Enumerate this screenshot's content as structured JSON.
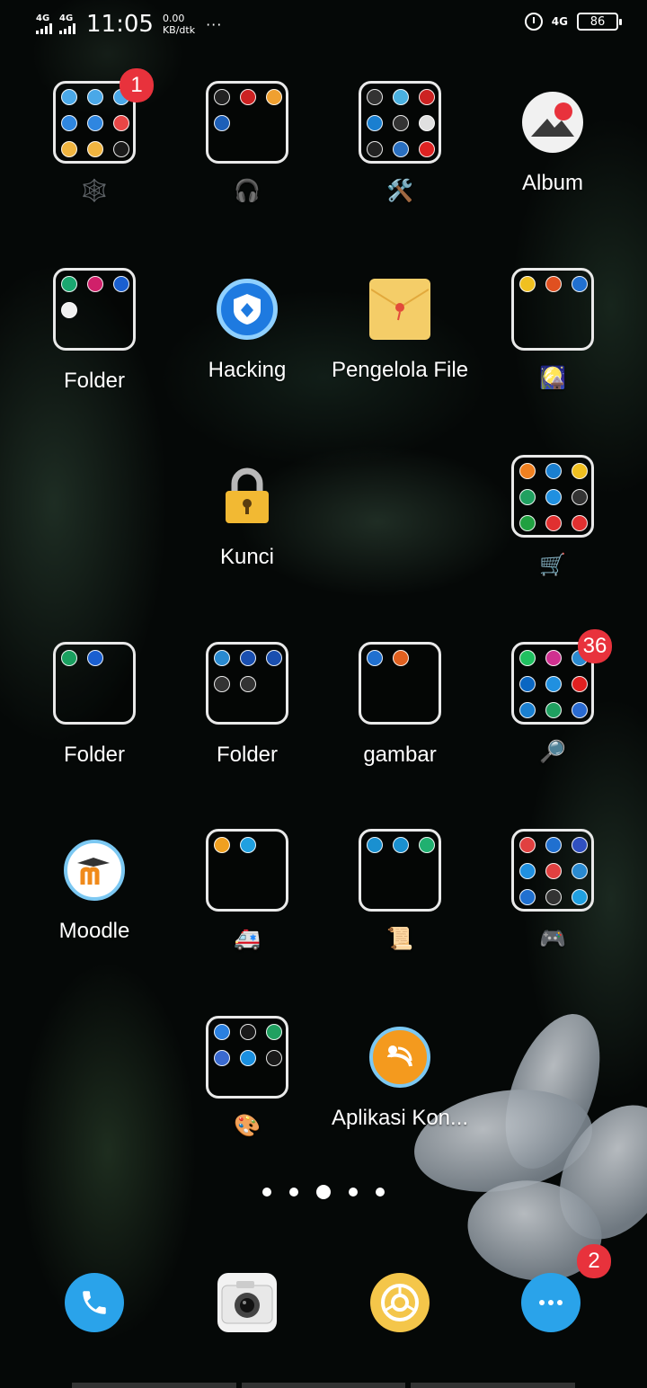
{
  "status_bar": {
    "sim1": "4G",
    "sim2": "4G",
    "time": "11:05",
    "speed_value": "0.00",
    "speed_unit": "KB/dtk",
    "more": "···",
    "net": "4G",
    "battery": "86"
  },
  "rows": [
    [
      {
        "type": "folder",
        "label": "🕸️",
        "badge": "1",
        "icon": "folder-web",
        "minis": [
          "#4aa8e8",
          "#4aa8e8",
          "#4aa8e8",
          "#2f86e0",
          "#2f86e0",
          "#e84646",
          "#f0b440",
          "#f0b440",
          "#1a1a1a"
        ]
      },
      {
        "type": "folder",
        "label": "🎧",
        "icon": "folder-music",
        "minis": [
          "#222",
          "#c22",
          "#f0a030",
          "#1d5fb8"
        ]
      },
      {
        "type": "folder",
        "label": "🛠️",
        "icon": "folder-tools",
        "minis": [
          "#333",
          "#4ab0e0",
          "#c22",
          "#1a7fd0",
          "#333",
          "#e0e0e0",
          "#222",
          "#2a6fc0",
          "#d22"
        ]
      },
      {
        "type": "app",
        "label": "Album",
        "icon": "album-icon"
      }
    ],
    [
      {
        "type": "folder",
        "label": "Folder",
        "icon": "folder-generic",
        "minis": [
          "#1aa870",
          "#d0206a",
          "#1a5fd0",
          "#f0f0f0"
        ]
      },
      {
        "type": "app",
        "label": "Hacking",
        "icon": "hacking-icon"
      },
      {
        "type": "app",
        "label": "Pengelola File",
        "icon": "file-manager-icon"
      },
      {
        "type": "folder",
        "label": "🎑",
        "icon": "folder-night",
        "minis": [
          "#f0c020",
          "#e05020",
          "#2070d0"
        ]
      }
    ],
    [
      {
        "type": "empty"
      },
      {
        "type": "app",
        "label": "Kunci",
        "icon": "lock-icon"
      },
      {
        "type": "empty"
      },
      {
        "type": "folder",
        "label": "🛒",
        "icon": "folder-shopping",
        "minis": [
          "#f08020",
          "#1a7fd0",
          "#f0c020",
          "#20a060",
          "#2090e0",
          "#333",
          "#20a040",
          "#e03030",
          "#e03030"
        ]
      }
    ],
    [
      {
        "type": "folder",
        "label": "Folder",
        "icon": "folder-generic-2",
        "minis": [
          "#1aa060",
          "#1a5fd0"
        ]
      },
      {
        "type": "folder",
        "label": "Folder",
        "icon": "folder-generic-3",
        "minis": [
          "#2a8ad0",
          "#1a4fb0",
          "#1a4fb0",
          "#333",
          "#333"
        ]
      },
      {
        "type": "folder",
        "label": "gambar",
        "icon": "folder-gambar",
        "minis": [
          "#2070d0",
          "#e06020"
        ]
      },
      {
        "type": "folder",
        "label": "🔎",
        "badge": "36",
        "icon": "folder-search",
        "minis": [
          "#20c060",
          "#d03090",
          "#2a8ad0",
          "#0a66c2",
          "#2090e0",
          "#e02020",
          "#1a7fd0",
          "#20a060",
          "#2a6ad0"
        ]
      }
    ],
    [
      {
        "type": "app",
        "label": "Moodle",
        "icon": "moodle-icon"
      },
      {
        "type": "folder",
        "label": "🚑",
        "icon": "folder-health",
        "minis": [
          "#f0a020",
          "#20a0e0"
        ]
      },
      {
        "type": "folder",
        "label": "📜",
        "icon": "folder-docs",
        "minis": [
          "#1a90d0",
          "#1a90d0",
          "#20b070"
        ]
      },
      {
        "type": "folder",
        "label": "🎮",
        "icon": "folder-games",
        "minis": [
          "#e04040",
          "#2070d0",
          "#3050c0",
          "#2090e0",
          "#e04040",
          "#2a8ad0",
          "#2070d0",
          "#333",
          "#20a0e0"
        ]
      }
    ],
    [
      {
        "type": "empty"
      },
      {
        "type": "folder",
        "label": "🎨",
        "icon": "folder-art",
        "minis": [
          "#2a80e0",
          "#1a1a1a",
          "#20a060",
          "#3a6ad0",
          "#1a8fe0",
          "#1a1a1a"
        ]
      },
      {
        "type": "app",
        "label": "Aplikasi Kon...",
        "icon": "connect-app-icon"
      },
      {
        "type": "empty"
      }
    ]
  ],
  "pager": {
    "count": 5,
    "active": 2
  },
  "dock": [
    {
      "name": "phone",
      "color": "#2aa3ea"
    },
    {
      "name": "camera",
      "color": "#f2f2f2"
    },
    {
      "name": "browser",
      "color": "#f4c64a"
    },
    {
      "name": "messages",
      "color": "#2aa3ea",
      "badge": "2"
    }
  ]
}
